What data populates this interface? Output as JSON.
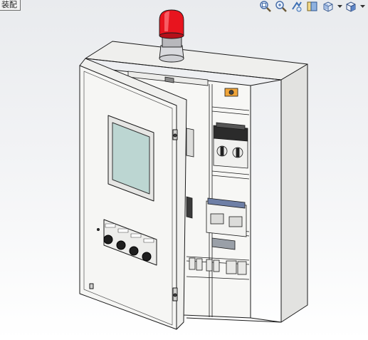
{
  "viewport": {
    "title_fragment": "装配",
    "background_top": "#e9ebee",
    "background_bottom": "#ffffff"
  },
  "toolbar": {
    "buttons": [
      {
        "name": "zoom-to-fit-icon"
      },
      {
        "name": "zoom-to-area-icon"
      },
      {
        "name": "previous-view-icon"
      },
      {
        "name": "section-view-icon"
      },
      {
        "name": "view-orientation-icon"
      },
      {
        "name": "display-style-icon"
      }
    ]
  },
  "model": {
    "name": "electrical-control-cabinet",
    "beacon_color": "#e8141e",
    "body_color": "#f4f4f2",
    "screen_color": "#bcd6d2",
    "door_state": "open"
  }
}
